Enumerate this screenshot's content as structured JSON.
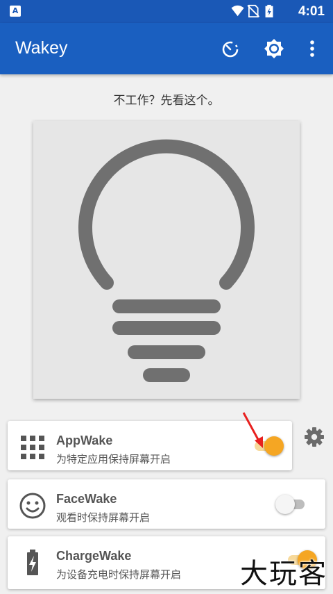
{
  "status_bar": {
    "time": "4:01",
    "notification_icon": "accessibility-notification-icon",
    "icons": [
      "wifi-icon",
      "no-sim-icon",
      "battery-charging-icon"
    ]
  },
  "app_bar": {
    "title": "Wakey",
    "actions": [
      "timer-icon",
      "brightness-icon",
      "more-vert-icon"
    ]
  },
  "hint": "不工作？先看这个。",
  "bulb": {
    "icon": "lightbulb-icon",
    "color": "#707070"
  },
  "modes": [
    {
      "icon": "apps-grid-icon",
      "title": "AppWake",
      "subtitle": "为特定应用保持屏幕开启",
      "enabled": true,
      "has_settings": true
    },
    {
      "icon": "face-icon",
      "title": "FaceWake",
      "subtitle": "观看时保持屏幕开启",
      "enabled": false,
      "has_settings": false
    },
    {
      "icon": "battery-charging-icon",
      "title": "ChargeWake",
      "subtitle": "为设备充电时保持屏幕开启",
      "enabled": true,
      "has_settings": false
    }
  ],
  "colors": {
    "primary": "#1a5fc0",
    "status_bar": "#1a58b6",
    "accent": "#f5a623",
    "annotation_arrow": "#e8201f"
  },
  "watermark": "大玩客"
}
